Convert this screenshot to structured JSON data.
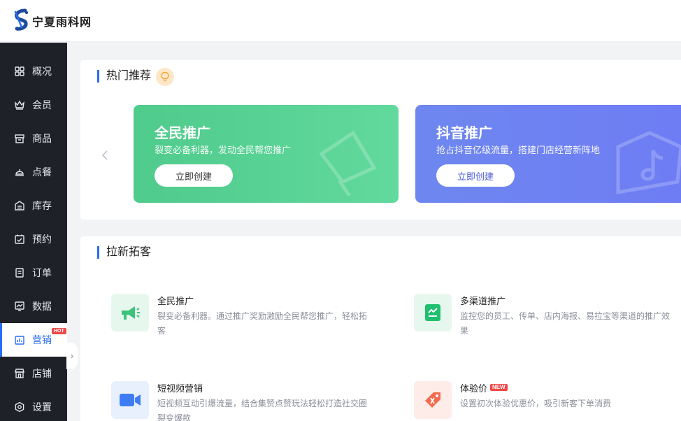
{
  "header": {
    "brand": "宁夏雨科网"
  },
  "sidebar": {
    "items": [
      {
        "label": "概况",
        "icon": "grid-icon"
      },
      {
        "label": "会员",
        "icon": "crown-icon"
      },
      {
        "label": "商品",
        "icon": "store-icon"
      },
      {
        "label": "点餐",
        "icon": "dish-icon"
      },
      {
        "label": "库存",
        "icon": "inventory-icon"
      },
      {
        "label": "预约",
        "icon": "calendar-check-icon"
      },
      {
        "label": "订单",
        "icon": "order-list-icon"
      },
      {
        "label": "数据",
        "icon": "data-chart-icon"
      },
      {
        "label": "营销",
        "icon": "marketing-icon",
        "badge": "HOT",
        "active": true
      },
      {
        "label": "店铺",
        "icon": "shop-icon"
      },
      {
        "label": "设置",
        "icon": "settings-icon"
      }
    ]
  },
  "hot_section": {
    "title": "热门推荐",
    "cards": [
      {
        "title": "全民推广",
        "subtitle": "裂变必备利器，发动全民帮您推广",
        "button": "立即创建"
      },
      {
        "title": "抖音推广",
        "subtitle": "抢占抖音亿级流量，搭建门店经营新阵地",
        "button": "立即创建"
      }
    ]
  },
  "acquire_section": {
    "title": "拉新拓客",
    "features": [
      {
        "title": "全民推广",
        "desc": "裂变必备利器。通过推广奖励激励全民帮您推广，轻松拓客",
        "icon": "megaphone-icon"
      },
      {
        "title": "多渠道推广",
        "desc": "监控您的员工、传单、店内海报、易拉宝等渠道的推广效果",
        "icon": "channel-report-icon"
      },
      {
        "title": "短视频营销",
        "desc": "短视频互动引爆流量，结合集赞点赞玩法轻松打造社交圈裂变爆款",
        "icon": "video-camera-icon"
      },
      {
        "title": "体验价",
        "badge": "NEW",
        "desc": "设置初次体验优惠价，吸引新客下单消费",
        "icon": "price-tag-icon"
      }
    ]
  },
  "colors": {
    "accent": "#2a6df4",
    "sidebar_bg": "#1f2129",
    "hot_badge": "#f04848"
  }
}
